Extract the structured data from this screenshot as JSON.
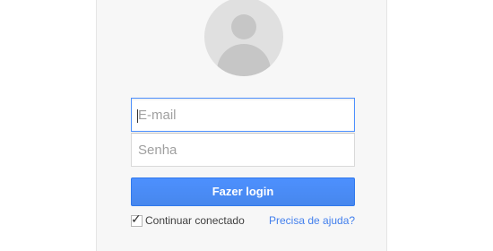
{
  "login": {
    "email_placeholder": "E-mail",
    "password_placeholder": "Senha",
    "submit_label": "Fazer login",
    "stay_signed_in_label": "Continuar conectado",
    "stay_signed_in_checked": true,
    "help_link_label": "Precisa de ajuda?"
  },
  "icons": {
    "avatar": "user-avatar-icon",
    "checkmark": "checkmark-icon"
  },
  "colors": {
    "button_blue": "#4d90fe",
    "focus_border": "#4d90fe",
    "link_blue": "#427fed",
    "card_bg": "#f7f7f7"
  }
}
